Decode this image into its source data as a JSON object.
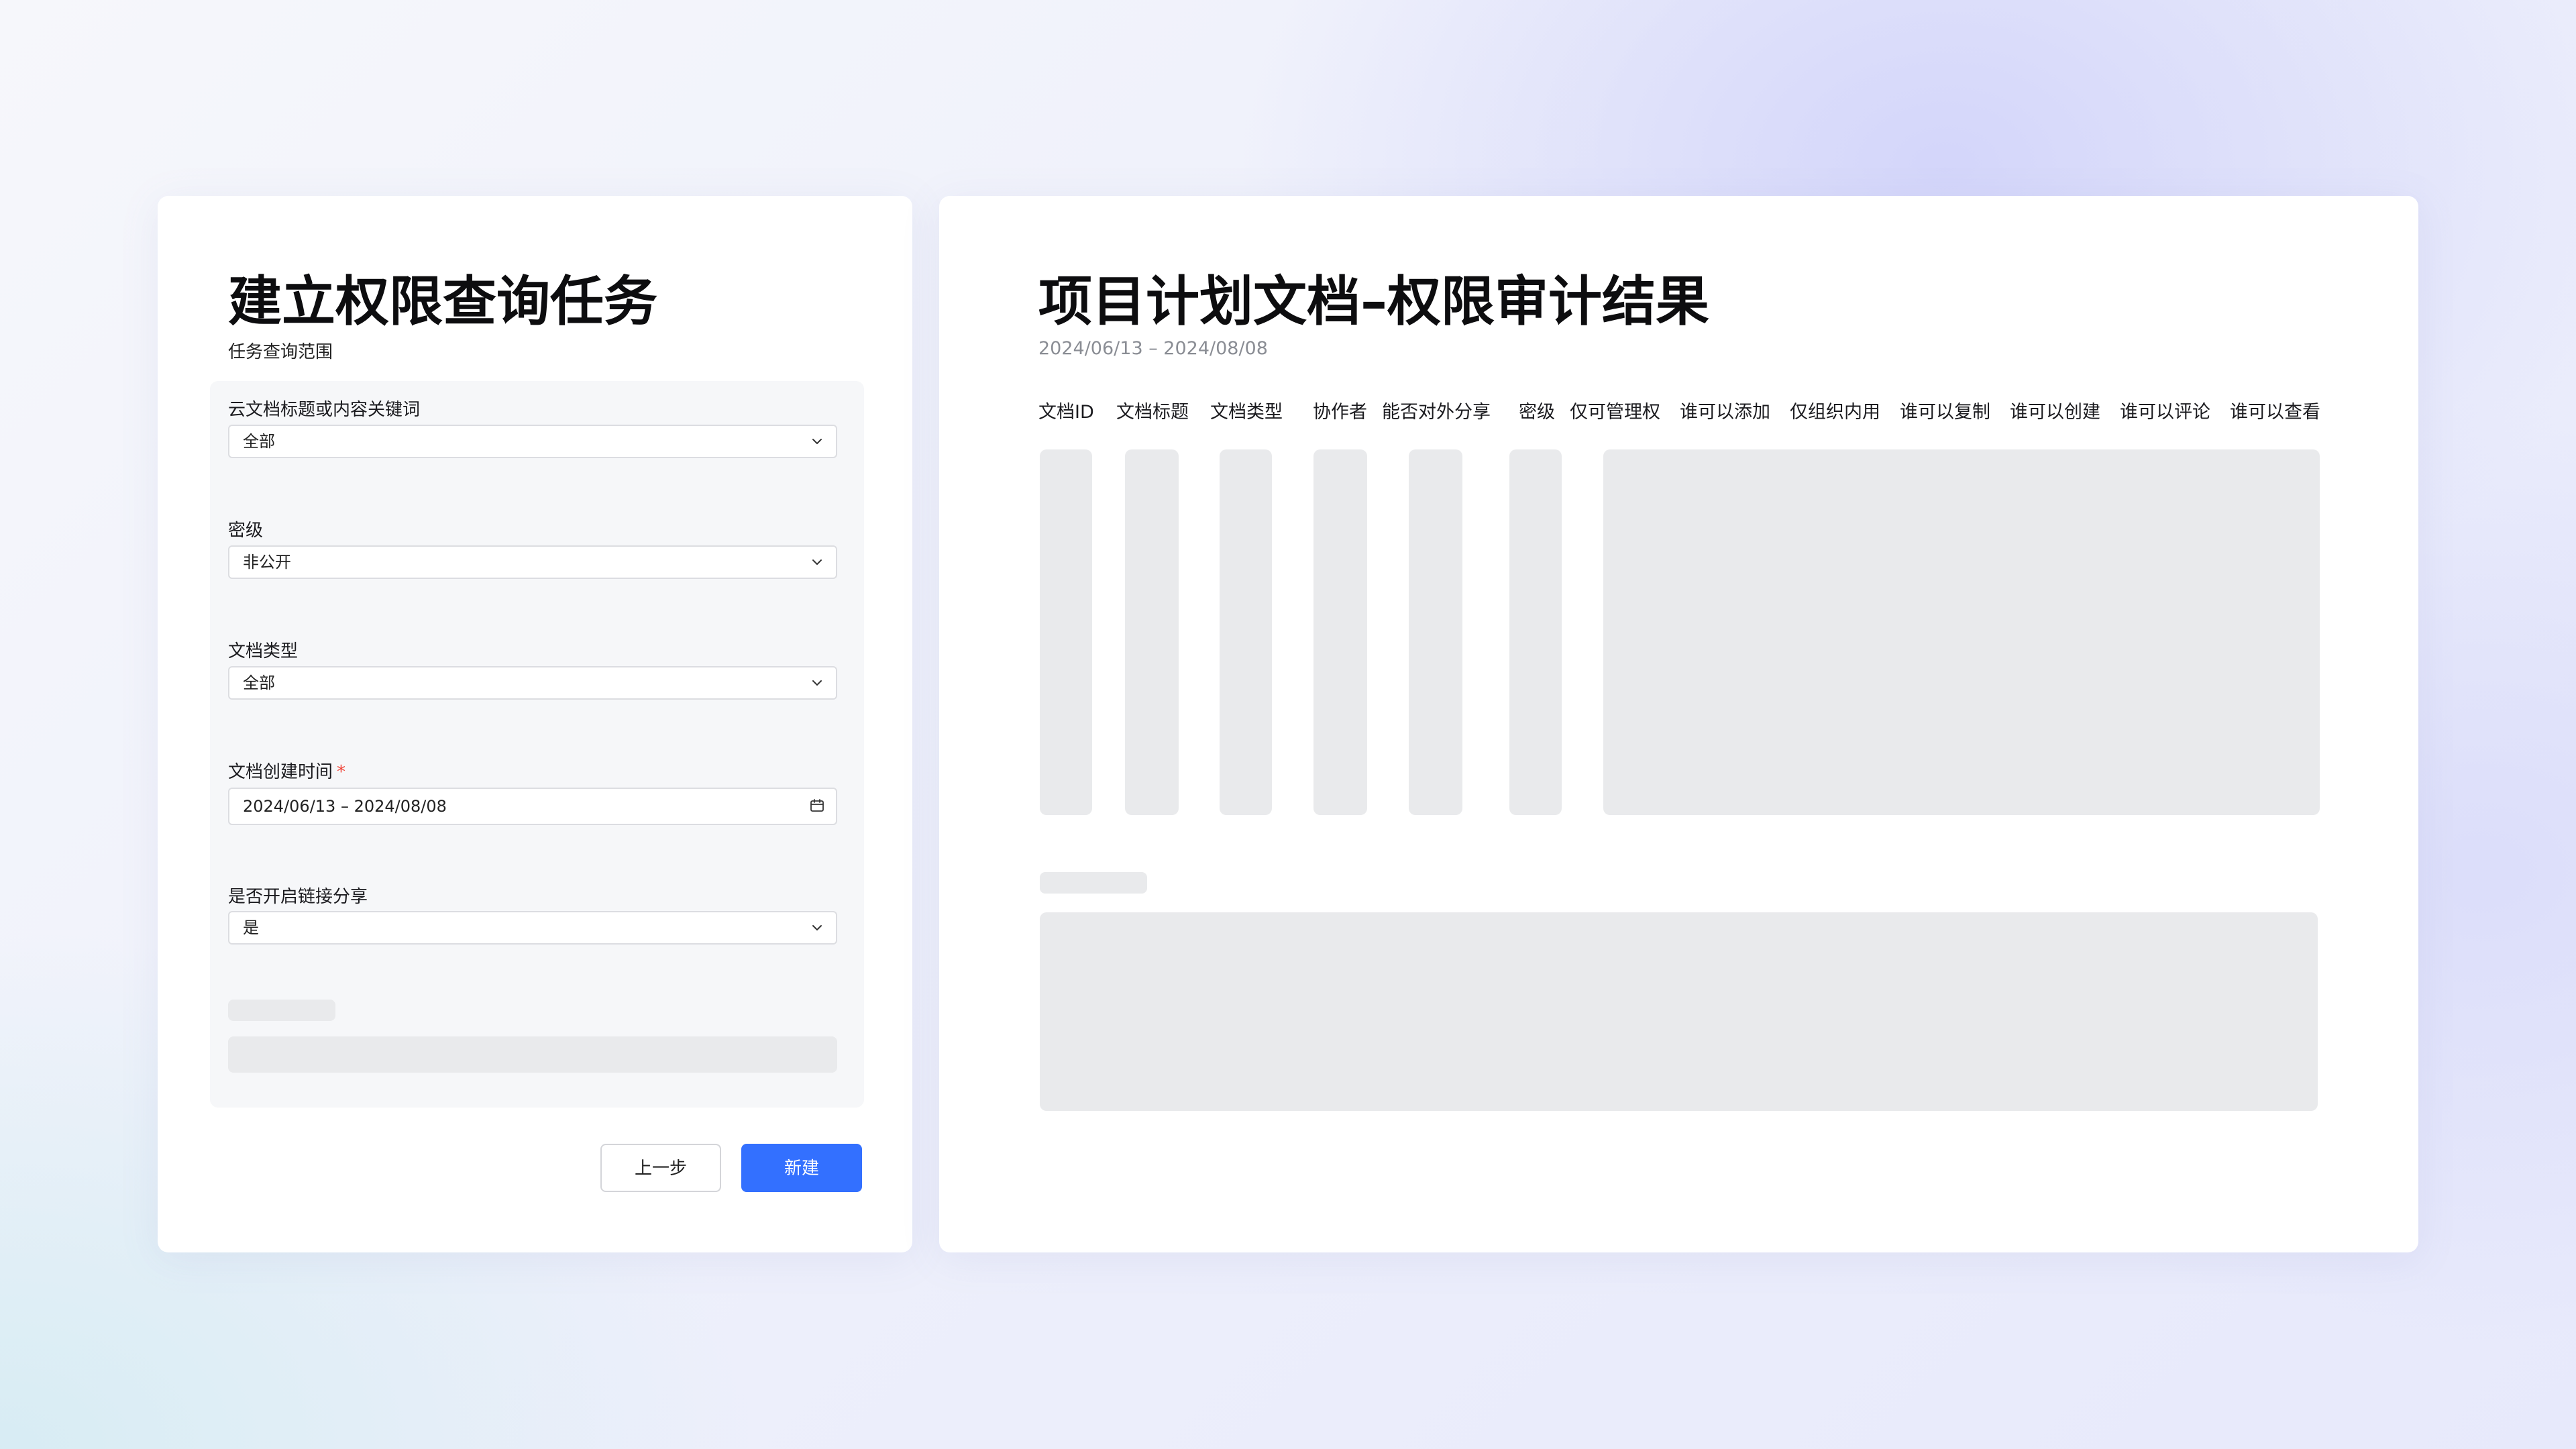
{
  "left_panel": {
    "title": "建立权限查询任务",
    "subtitle": "任务查询范围",
    "fields": [
      {
        "label": "云文档标题或内容关键词",
        "value": "全部",
        "icon": "chevron-down-icon"
      },
      {
        "label": "密级",
        "value": "非公开",
        "icon": "chevron-down-icon"
      },
      {
        "label": "文档类型",
        "value": "全部",
        "icon": "chevron-down-icon"
      },
      {
        "label": "文档创建时间",
        "required_mark": "*",
        "value": "2024/06/13 – 2024/08/08",
        "icon": "calendar-icon"
      },
      {
        "label": "是否开启链接分享",
        "value": "是",
        "icon": "chevron-down-icon"
      }
    ],
    "buttons": {
      "prev": "上一步",
      "create": "新建"
    }
  },
  "right_panel": {
    "title": "项目计划文档–权限审计结果",
    "subtitle": "2024/06/13 – 2024/08/08",
    "columns": [
      "文档ID",
      "文档标题",
      "文档类型",
      "协作者",
      "能否对外分享",
      "密级",
      "仅可管理权",
      "谁可以添加",
      "仅组织内用",
      "谁可以复制",
      "谁可以创建",
      "谁可以评论",
      "谁可以查看"
    ]
  },
  "colors": {
    "primary": "#3370ff",
    "required": "#f04438",
    "skeleton": "#e9eaec",
    "panel_bg": "#f6f7f9"
  }
}
